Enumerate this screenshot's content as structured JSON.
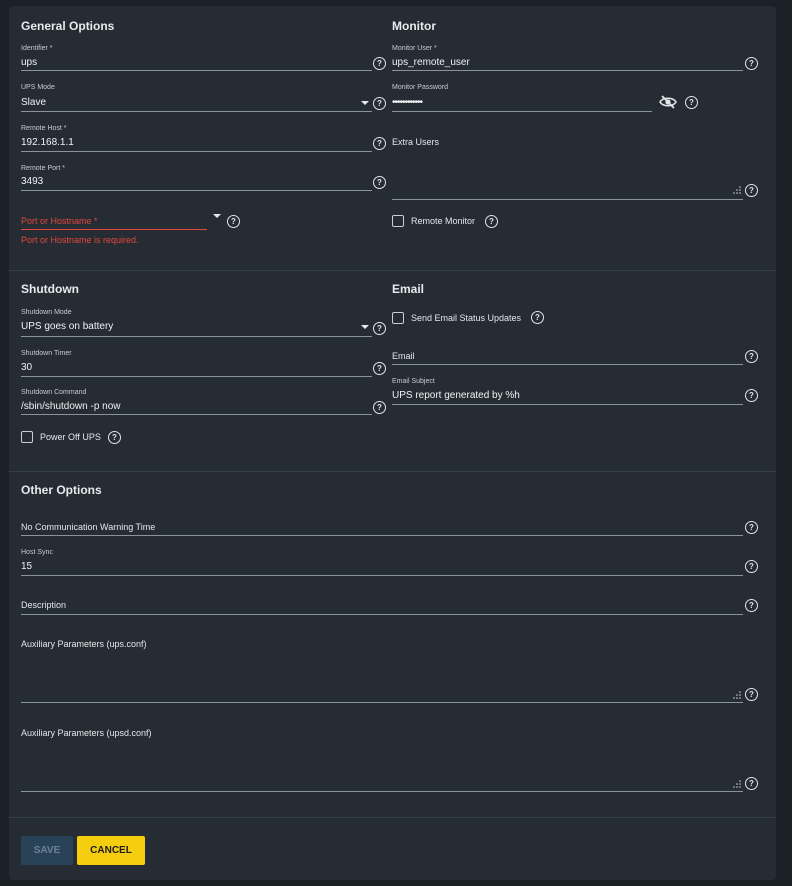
{
  "general": {
    "title": "General Options",
    "identifier": {
      "label": "Identifier *",
      "value": "ups"
    },
    "ups_mode": {
      "label": "UPS Mode",
      "value": "Slave"
    },
    "remote_host": {
      "label": "Remote Host *",
      "value": "192.168.1.1"
    },
    "remote_port": {
      "label": "Remote Port *",
      "value": "3493"
    },
    "port_hostname": {
      "placeholder": "Port or Hostname *",
      "error": "Port or Hostname is required."
    }
  },
  "monitor": {
    "title": "Monitor",
    "user": {
      "label": "Monitor User *",
      "value": "ups_remote_user"
    },
    "password": {
      "label": "Monitor Password",
      "value": "••••••••••••"
    },
    "extra_users": {
      "label": "Extra Users",
      "value": ""
    },
    "remote_monitor": {
      "label": "Remote Monitor",
      "checked": false
    }
  },
  "shutdown": {
    "title": "Shutdown",
    "mode": {
      "label": "Shutdown Mode",
      "value": "UPS goes on battery"
    },
    "timer": {
      "label": "Shutdown Timer",
      "value": "30"
    },
    "command": {
      "label": "Shutdown Command",
      "value": "/sbin/shutdown -p now"
    },
    "power_off": {
      "label": "Power Off UPS",
      "checked": false
    }
  },
  "email": {
    "title": "Email",
    "send_updates": {
      "label": "Send Email Status Updates",
      "checked": false
    },
    "email": {
      "label": "Email",
      "value": ""
    },
    "subject": {
      "label": "Email Subject",
      "value": "UPS report generated by %h"
    }
  },
  "other": {
    "title": "Other Options",
    "no_comm": {
      "label": "No Communication Warning Time",
      "value": ""
    },
    "host_sync": {
      "label": "Host Sync",
      "value": "15"
    },
    "description": {
      "label": "Description",
      "value": ""
    },
    "aux_ups": {
      "label": "Auxiliary Parameters (ups.conf)",
      "value": ""
    },
    "aux_upsd": {
      "label": "Auxiliary Parameters (upsd.conf)",
      "value": ""
    }
  },
  "actions": {
    "save": "SAVE",
    "cancel": "CANCEL"
  },
  "icons": {
    "help": "help-circle-icon",
    "eye": "eye-off-icon",
    "dropdown": "chevron-down-icon",
    "resize": "resize-handle-icon"
  },
  "colors": {
    "accent": "#f3cd0e",
    "error": "#e5473c",
    "panel": "#252c33",
    "background": "#1c2127"
  }
}
